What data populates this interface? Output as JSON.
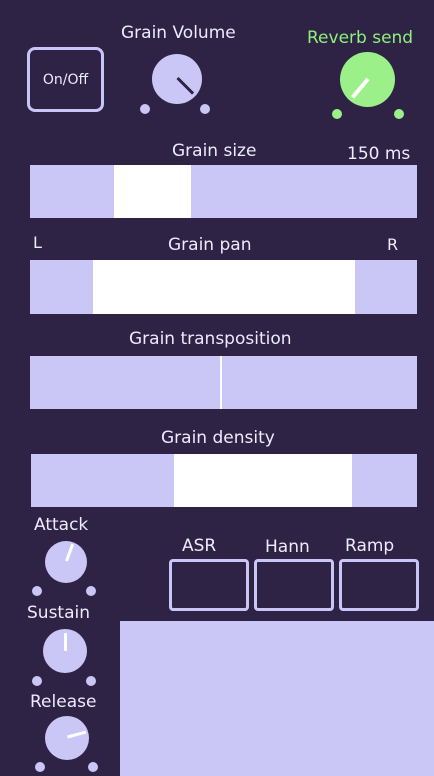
{
  "header": {
    "onoff_label": "On/Off",
    "grain_volume_label": "Grain Volume",
    "reverb_send_label": "Reverb send"
  },
  "knobs": {
    "grain_volume": {
      "color": "#cac7f7",
      "angle_deg": 135
    },
    "reverb_send": {
      "color": "#9cf08a",
      "angle_deg": 220
    },
    "attack": {
      "color": "#cac7f7",
      "angle_deg": 200
    },
    "sustain": {
      "color": "#cac7f7",
      "angle_deg": 180
    },
    "release": {
      "color": "#cac7f7",
      "angle_deg": 255
    }
  },
  "sliders": {
    "grain_size": {
      "label": "Grain size",
      "value_text": "150 ms",
      "range_start": 0.218,
      "range_end": 0.415
    },
    "grain_pan": {
      "label": "Grain pan",
      "left_label": "L",
      "right_label": "R",
      "range_start": 0.163,
      "range_end": 0.84
    },
    "grain_transposition": {
      "label": "Grain transposition",
      "center": 0.5
    },
    "grain_density": {
      "label": "Grain density",
      "range_start": 0.37,
      "range_end": 0.83
    }
  },
  "envelope": {
    "attack_label": "Attack",
    "sustain_label": "Sustain",
    "release_label": "Release",
    "shapes": [
      "ASR",
      "Hann",
      "Ramp"
    ]
  },
  "colors": {
    "background": "#2e2344",
    "track": "#cac7f7",
    "accent_green": "#9cf08a"
  }
}
